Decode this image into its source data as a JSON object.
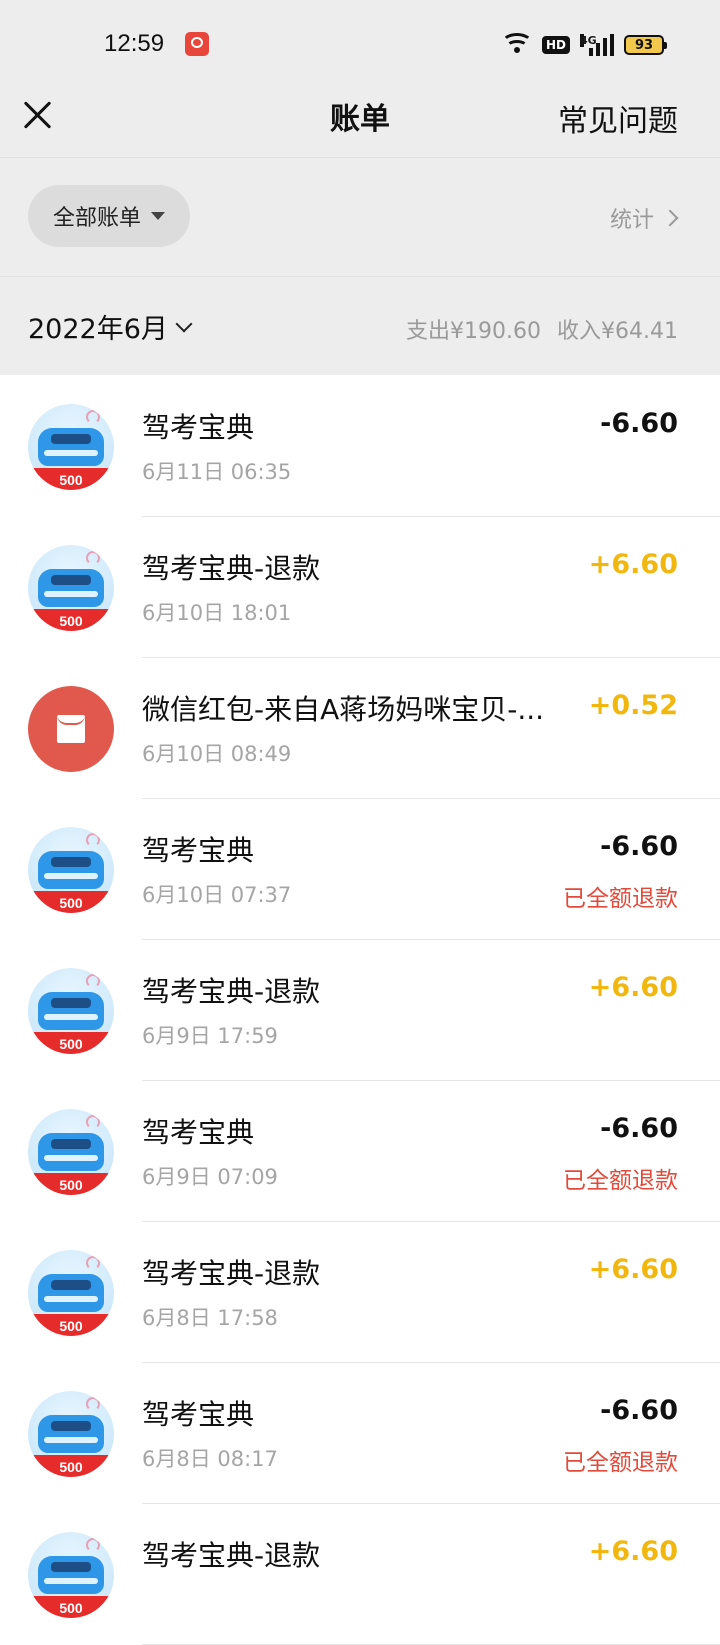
{
  "status_bar": {
    "time": "12:59",
    "network": "4G",
    "hd": "HD",
    "battery": "93"
  },
  "header": {
    "title": "账单",
    "right_link": "常见问题",
    "close_icon": "close-icon"
  },
  "filter": {
    "selected": "全部账单",
    "stats_label": "统计"
  },
  "month": {
    "label": "2022年6月",
    "expense": "支出¥190.60",
    "income": "收入¥64.41"
  },
  "colors": {
    "income": "#f2b70f",
    "refund_note": "#e24b3b",
    "background": "#ededed"
  },
  "transactions": [
    {
      "icon": "car-app-icon",
      "title": "驾考宝典",
      "time": "6月11日 06:35",
      "amount": "-6.60",
      "type": "expense",
      "note": ""
    },
    {
      "icon": "car-app-icon",
      "title": "驾考宝典-退款",
      "time": "6月10日 18:01",
      "amount": "+6.60",
      "type": "income",
      "note": ""
    },
    {
      "icon": "red-packet-icon",
      "title": "微信红包-来自A蒋场妈咪宝贝-...",
      "time": "6月10日 08:49",
      "amount": "+0.52",
      "type": "income",
      "note": ""
    },
    {
      "icon": "car-app-icon",
      "title": "驾考宝典",
      "time": "6月10日 07:37",
      "amount": "-6.60",
      "type": "expense",
      "note": "已全额退款"
    },
    {
      "icon": "car-app-icon",
      "title": "驾考宝典-退款",
      "time": "6月9日 17:59",
      "amount": "+6.60",
      "type": "income",
      "note": ""
    },
    {
      "icon": "car-app-icon",
      "title": "驾考宝典",
      "time": "6月9日 07:09",
      "amount": "-6.60",
      "type": "expense",
      "note": "已全额退款"
    },
    {
      "icon": "car-app-icon",
      "title": "驾考宝典-退款",
      "time": "6月8日 17:58",
      "amount": "+6.60",
      "type": "income",
      "note": ""
    },
    {
      "icon": "car-app-icon",
      "title": "驾考宝典",
      "time": "6月8日 08:17",
      "amount": "-6.60",
      "type": "expense",
      "note": "已全额退款"
    },
    {
      "icon": "car-app-icon",
      "title": "驾考宝典-退款",
      "time": "",
      "amount": "+6.60",
      "type": "income",
      "note": ""
    }
  ],
  "avatar_badge": "500"
}
